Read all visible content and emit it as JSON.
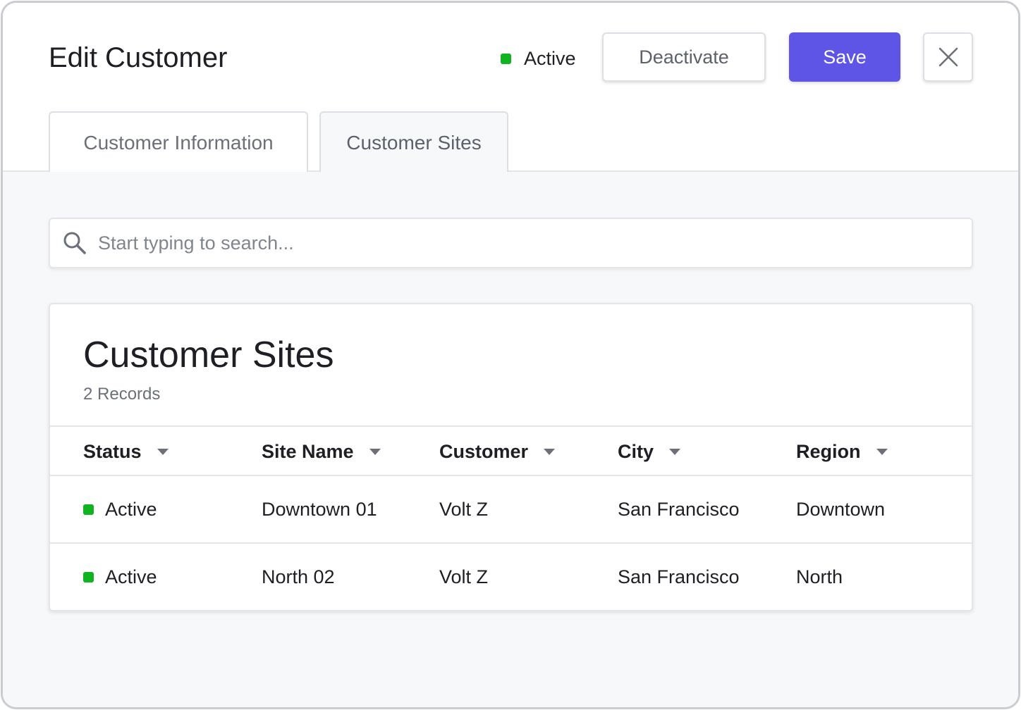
{
  "window": {
    "title": "Edit Customer"
  },
  "header": {
    "status_label": "Active",
    "deactivate_label": "Deactivate",
    "save_label": "Save"
  },
  "tabs": [
    {
      "label": "Customer Information",
      "selected": false
    },
    {
      "label": "Customer Sites",
      "selected": true
    }
  ],
  "search": {
    "placeholder": "Start typing to search...",
    "value": "",
    "icon": "search-icon"
  },
  "sites": {
    "title": "Customer Sites",
    "record_count": "2 Records",
    "columns": [
      "Status",
      "Site Name",
      "Customer",
      "City",
      "Region"
    ],
    "rows": [
      {
        "status": "Active",
        "site_name": "Downtown 01",
        "customer": "Volt Z",
        "city": "San Francisco",
        "region": "Downtown"
      },
      {
        "status": "Active",
        "site_name": "North 02",
        "customer": "Volt Z",
        "city": "San Francisco",
        "region": "North"
      }
    ]
  },
  "icons": {
    "close": "close-icon",
    "sort": "caret-down-icon",
    "status": "status-dot-icon"
  },
  "colors": {
    "accent": "#5e55e6",
    "active_status": "#12b322",
    "border": "#dcdfe3",
    "body_bg": "#f7f8fa"
  }
}
